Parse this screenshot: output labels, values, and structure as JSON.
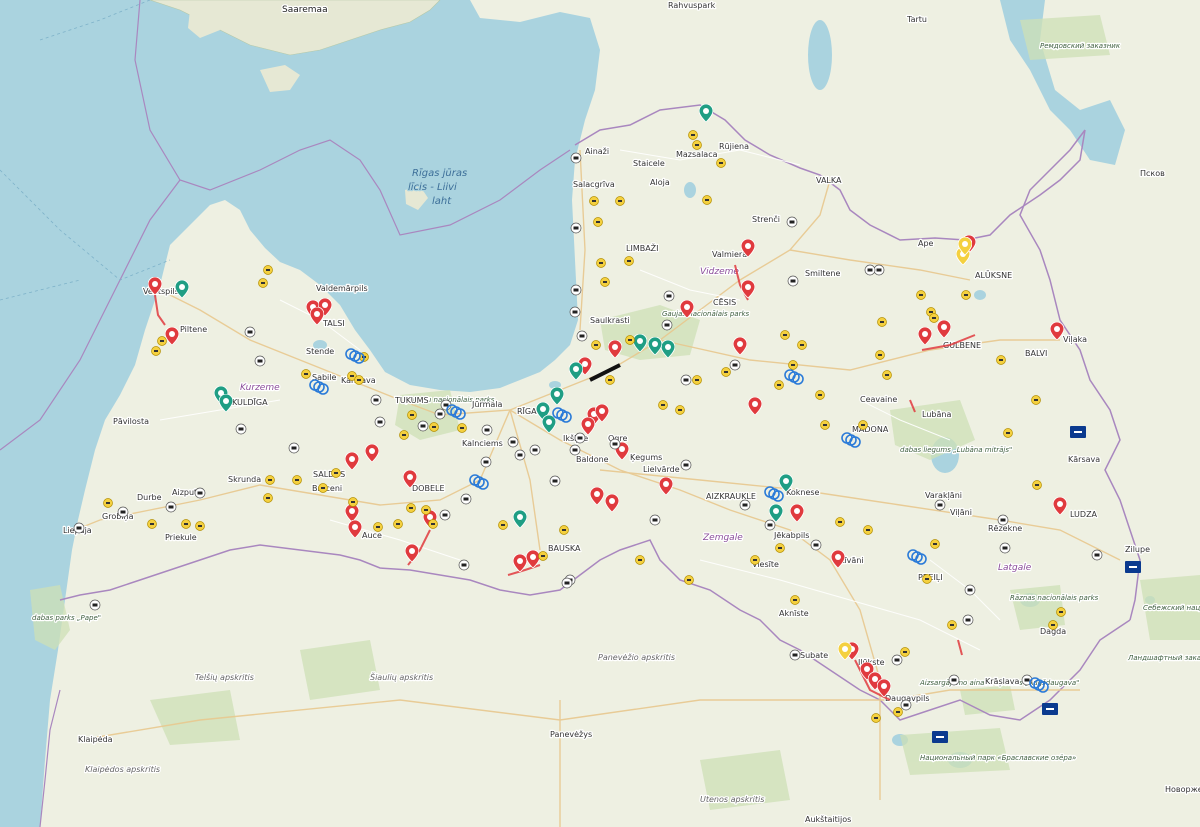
{
  "map": {
    "water_labels": [
      {
        "text": "Saaremaa",
        "cls": "big"
      },
      {
        "text": "Rīgas jūras",
        "cls": "water"
      },
      {
        "text": "līcis - Liivi",
        "cls": "water"
      },
      {
        "text": "laht",
        "cls": "water"
      }
    ],
    "region_labels": [
      "Vidzeme",
      "Kurzeme",
      "Zemgale",
      "Latgale"
    ],
    "admin_labels": [
      "Telšių apskritis",
      "Šiaulių apskritis",
      "Panevėžio apskritis",
      "Klaipėdos apskritis",
      "Utenos apskritis"
    ],
    "park_labels": [
      "Gaujas nacionālais parks",
      "Ķemeru nacionālais parks",
      "dabas parks „Pape\"",
      "dabas liegums „Lubāna mitrājs\"",
      "Rāznas nacionālais parks",
      "Aizsargājamo ainavu apvidus „Augšdaugava\"",
      "Ремдовский заказник",
      "Себежский национальный парк",
      "Национальный парк «Браславские озёра»",
      "Ландшафтный заказник «Красный Бор»"
    ],
    "cities": [
      "Tartu",
      "Rahvuspark",
      "Ainaži",
      "Staicele",
      "Mazsalaca",
      "Rūjiena",
      "Salacgrīva",
      "Aloja",
      "VALKA",
      "Strenči",
      "LIMBAŽI",
      "Valmiera",
      "Smiltene",
      "Ape",
      "ALŪKSNE",
      "CĒSIS",
      "Saulkrasti",
      "Ventspils",
      "Valdemārpils",
      "TALSI",
      "Piltene",
      "Stende",
      "Sabile",
      "Kandava",
      "KULDĪGA",
      "Pāvilosta",
      "TUKUMS",
      "Jūrmala",
      "RĪGA",
      "Kalnciems",
      "Ogre",
      "Ikšķile",
      "Baldone",
      "Ķegums",
      "Lielvārde",
      "Aizpute",
      "Skrunda",
      "SALDUS",
      "Broceni",
      "DOBELE",
      "Durbe",
      "Grobiņa",
      "Liepāja",
      "Priekule",
      "Auce",
      "BAUSKA",
      "AIZKRAUKLE",
      "Koknese",
      "Jēkabpils",
      "Viesīte",
      "Aknīste",
      "Līvāni",
      "PREIĻI",
      "Varakļāni",
      "Viļāni",
      "Rēzekne",
      "Kārsava",
      "LUDZA",
      "Zilupe",
      "Dagda",
      "Krāslava",
      "Daugavpils",
      "Ilūkste",
      "Subate",
      "Ceavaine",
      "Lubāna",
      "MADONA",
      "GULBENE",
      "BALVI",
      "Viļaka",
      "Klaipėda",
      "Panevėžys",
      "Aukštaitijos",
      "Псков",
      "Новоржев"
    ],
    "marker_colors": {
      "red": "#e03a3e",
      "teal": "#1f9e84",
      "yellow": "#f4d03f",
      "blue": "#2b7bd8",
      "navy": "#0b3a8f"
    },
    "marker_icons": [
      "ski-icon",
      "camera-icon",
      "construction-icon",
      "traffic-jam-icon",
      "info-icon"
    ]
  }
}
